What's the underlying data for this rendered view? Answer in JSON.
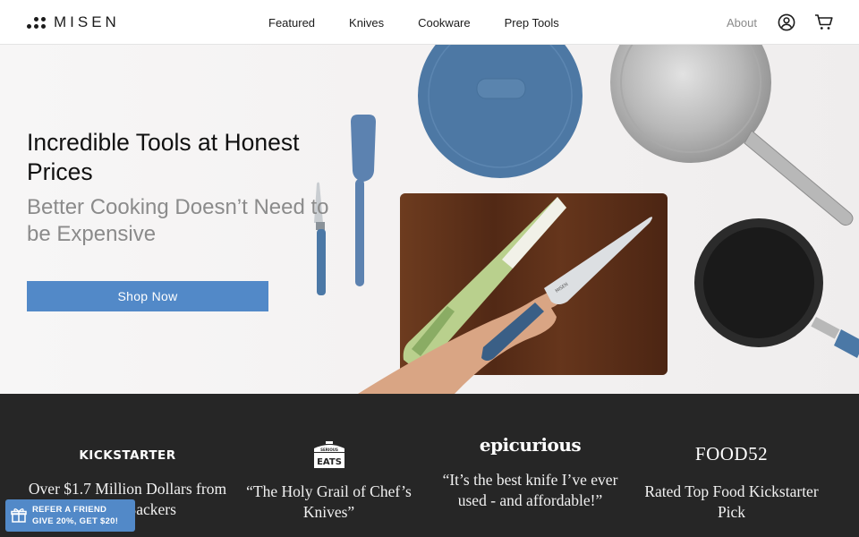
{
  "brand": {
    "name": "MISEN"
  },
  "nav": {
    "items": [
      "Featured",
      "Knives",
      "Cookware",
      "Prep Tools"
    ]
  },
  "header": {
    "about_label": "About",
    "account_icon": "account-icon",
    "cart_icon": "cart-icon"
  },
  "hero": {
    "title": "Incredible Tools at Honest Prices",
    "subtitle": "Better Cooking Doesn’t Need to be Expensive",
    "cta_label": "Shop Now",
    "knife_blade_text": "MISEN"
  },
  "press": [
    {
      "logo_text": "KICKSTARTER",
      "quote": "Over $1.7 Million Dollars from 20,000 Backers"
    },
    {
      "logo_text_top": "SERIOUS",
      "logo_text": "EATS",
      "quote": "“The Holy Grail of Chef’s Knives”"
    },
    {
      "logo_text": "epicurious",
      "quote": "“It’s the best knife I’ve ever used - and affordable!”"
    },
    {
      "logo_text": "FOOD52",
      "quote": "Rated Top Food Kickstarter Pick"
    }
  ],
  "refer": {
    "line1": "REFER A FRIEND",
    "line2": "GIVE 20%, GET $20!",
    "icon": "gift-icon"
  },
  "colors": {
    "accent": "#5289c8",
    "press_bg": "#262626",
    "text_dark": "#111111",
    "text_muted": "#8b8b8b"
  }
}
